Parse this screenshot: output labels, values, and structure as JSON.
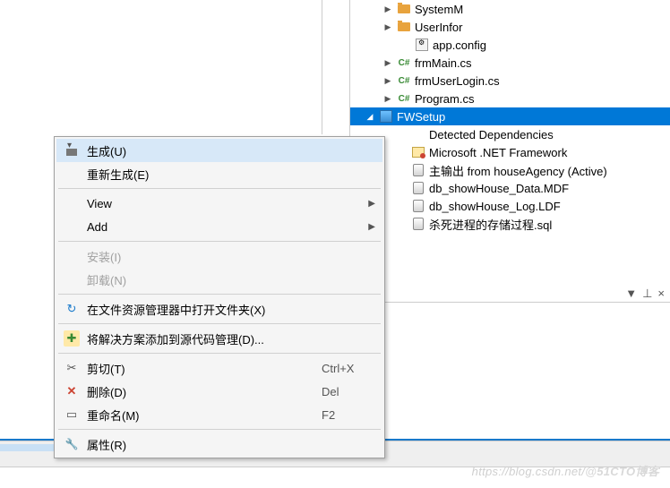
{
  "tree": {
    "items": [
      {
        "label": "SystemM",
        "icon": "folder",
        "indent": "indent1",
        "arrow": "▶"
      },
      {
        "label": "UserInfor",
        "icon": "folder",
        "indent": "indent1",
        "arrow": "▶"
      },
      {
        "label": "app.config",
        "icon": "cfg",
        "indent": "indent2",
        "arrow": ""
      },
      {
        "label": "frmMain.cs",
        "icon": "cs",
        "indent": "indent1",
        "arrow": "▶"
      },
      {
        "label": "frmUserLogin.cs",
        "icon": "cs",
        "indent": "indent1",
        "arrow": "▶"
      },
      {
        "label": "Program.cs",
        "icon": "cs",
        "indent": "indent1",
        "arrow": "▶"
      }
    ],
    "selected": {
      "label": "FWSetup",
      "icon": "setup",
      "arrow": "◢"
    },
    "sub": [
      {
        "label": "Detected Dependencies",
        "icon": "",
        "indent": "indent2b"
      },
      {
        "label": "Microsoft .NET Framework",
        "icon": "net",
        "indent": "indent2b"
      },
      {
        "label": "主输出 from houseAgency (Active)",
        "icon": "out",
        "indent": "indent2b"
      },
      {
        "label": "db_showHouse_Data.MDF",
        "icon": "db",
        "indent": "indent2b"
      },
      {
        "label": "db_showHouse_Log.LDF",
        "icon": "db",
        "indent": "indent2b"
      },
      {
        "label": "杀死进程的存储过程.sql",
        "icon": "db",
        "indent": "indent2b"
      }
    ]
  },
  "menu": {
    "items": [
      {
        "key": "build",
        "label": "生成(U)",
        "icon": "build",
        "hover": true
      },
      {
        "key": "rebuild",
        "label": "重新生成(E)"
      },
      {
        "sep": true
      },
      {
        "key": "view",
        "label": "View",
        "sub": true
      },
      {
        "key": "add",
        "label": "Add",
        "sub": true
      },
      {
        "sep": true
      },
      {
        "key": "install",
        "label": "安装(I)",
        "disabled": true
      },
      {
        "key": "unload",
        "label": "卸载(N)",
        "disabled": true
      },
      {
        "sep": true
      },
      {
        "key": "openfolder",
        "label": "在文件资源管理器中打开文件夹(X)",
        "icon": "open"
      },
      {
        "sep": true
      },
      {
        "key": "addsrc",
        "label": "将解决方案添加到源代码管理(D)...",
        "icon": "src"
      },
      {
        "sep": true
      },
      {
        "key": "cut",
        "label": "剪切(T)",
        "icon": "cut",
        "short": "Ctrl+X"
      },
      {
        "key": "delete",
        "label": "删除(D)",
        "icon": "del",
        "short": "Del"
      },
      {
        "key": "rename",
        "label": "重命名(M)",
        "icon": "ren",
        "short": "F2"
      },
      {
        "sep": true
      },
      {
        "key": "prop",
        "label": "属性(R)",
        "icon": "wrench"
      }
    ]
  },
  "pin": {
    "drop": "▼",
    "pin": "⊥",
    "x": "×"
  },
  "watermark": {
    "a": "https://blog.csdn.net/",
    "b": "@51CTO博客"
  }
}
